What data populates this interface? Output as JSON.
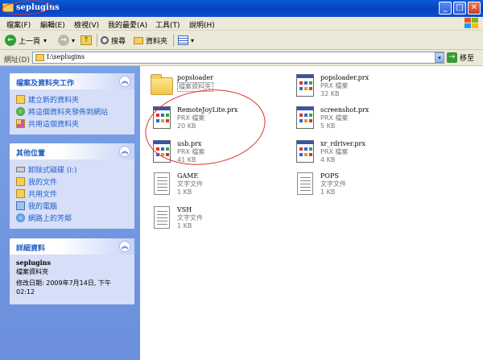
{
  "window": {
    "title": "seplugins",
    "minimize_label": "_",
    "maximize_label": "□",
    "close_label": "✕"
  },
  "menu": {
    "items": [
      "檔案(F)",
      "編輯(E)",
      "檢視(V)",
      "我的最愛(A)",
      "工具(T)",
      "說明(H)"
    ]
  },
  "toolbar": {
    "back_label": "上一頁",
    "back_arrow": "←",
    "forward_arrow": "→",
    "up_arrow": "↑",
    "dropdown_glyph": "▾",
    "search_label": "搜尋",
    "folders_label": "資料夾"
  },
  "address": {
    "label": "網址(D)",
    "value": "I:\\seplugins",
    "go_label": "移至",
    "go_arrow": "→",
    "dropdown_glyph": "▾"
  },
  "left_pane": {
    "collapse_glyph": "︽",
    "tasks": {
      "title": "檔案及資料夾工作",
      "items": [
        "建立新的資料夾",
        "將這個資料夾發佈到網站",
        "共用這個資料夾"
      ]
    },
    "places": {
      "title": "其他位置",
      "items": [
        "卸除式磁碟 (I:)",
        "我的文件",
        "共用文件",
        "我的電腦",
        "網路上的芳鄰"
      ]
    },
    "details": {
      "title": "詳細資料",
      "name": "seplugins",
      "type": "檔案資料夾",
      "modified": "修改日期: 2009年7月14日, 下午 02:12"
    }
  },
  "files": [
    {
      "name": "popsloader",
      "type": "檔案資料夾",
      "size": "",
      "icon": "folder-icon"
    },
    {
      "name": "popsloader.prx",
      "type": "PRX 檔案",
      "size": "32 KB",
      "icon": "prx-file-icon"
    },
    {
      "name": "RemoteJoyLite.prx",
      "type": "PRX 檔案",
      "size": "20 KB",
      "icon": "prx-file-icon"
    },
    {
      "name": "screenshot.prx",
      "type": "PRX 檔案",
      "size": "5 KB",
      "icon": "prx-file-icon"
    },
    {
      "name": "usb.prx",
      "type": "PRX 檔案",
      "size": "41 KB",
      "icon": "prx-file-icon"
    },
    {
      "name": "xr_rdriver.prx",
      "type": "PRX 檔案",
      "size": "4 KB",
      "icon": "prx-file-icon"
    },
    {
      "name": "GAME",
      "type": "文字文件",
      "size": "1 KB",
      "icon": "text-file-icon"
    },
    {
      "name": "POPS",
      "type": "文字文件",
      "size": "1 KB",
      "icon": "text-file-icon"
    },
    {
      "name": "VSH",
      "type": "文字文件",
      "size": "1 KB",
      "icon": "text-file-icon"
    }
  ]
}
